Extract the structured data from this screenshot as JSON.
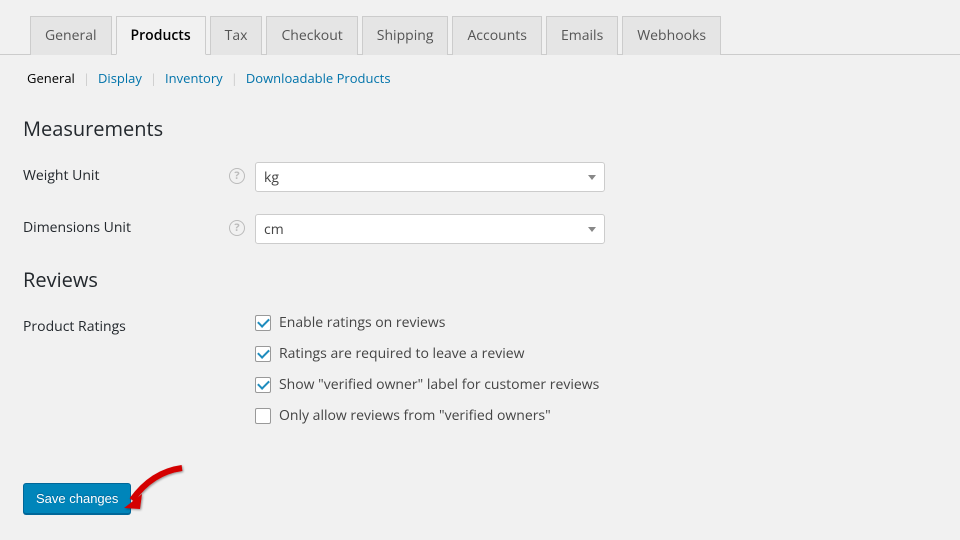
{
  "tabs": {
    "items": [
      "General",
      "Products",
      "Tax",
      "Checkout",
      "Shipping",
      "Accounts",
      "Emails",
      "Webhooks"
    ],
    "active": 1
  },
  "subnav": {
    "items": [
      "General",
      "Display",
      "Inventory",
      "Downloadable Products"
    ],
    "active": 0
  },
  "sections": {
    "measurements": {
      "title": "Measurements",
      "weight": {
        "label": "Weight Unit",
        "value": "kg"
      },
      "dimensions": {
        "label": "Dimensions Unit",
        "value": "cm"
      }
    },
    "reviews": {
      "title": "Reviews",
      "ratings_label": "Product Ratings",
      "checks": [
        {
          "label": "Enable ratings on reviews",
          "checked": true
        },
        {
          "label": "Ratings are required to leave a review",
          "checked": true
        },
        {
          "label": "Show \"verified owner\" label for customer reviews",
          "checked": true
        },
        {
          "label": "Only allow reviews from \"verified owners\"",
          "checked": false
        }
      ]
    }
  },
  "save_label": "Save changes"
}
